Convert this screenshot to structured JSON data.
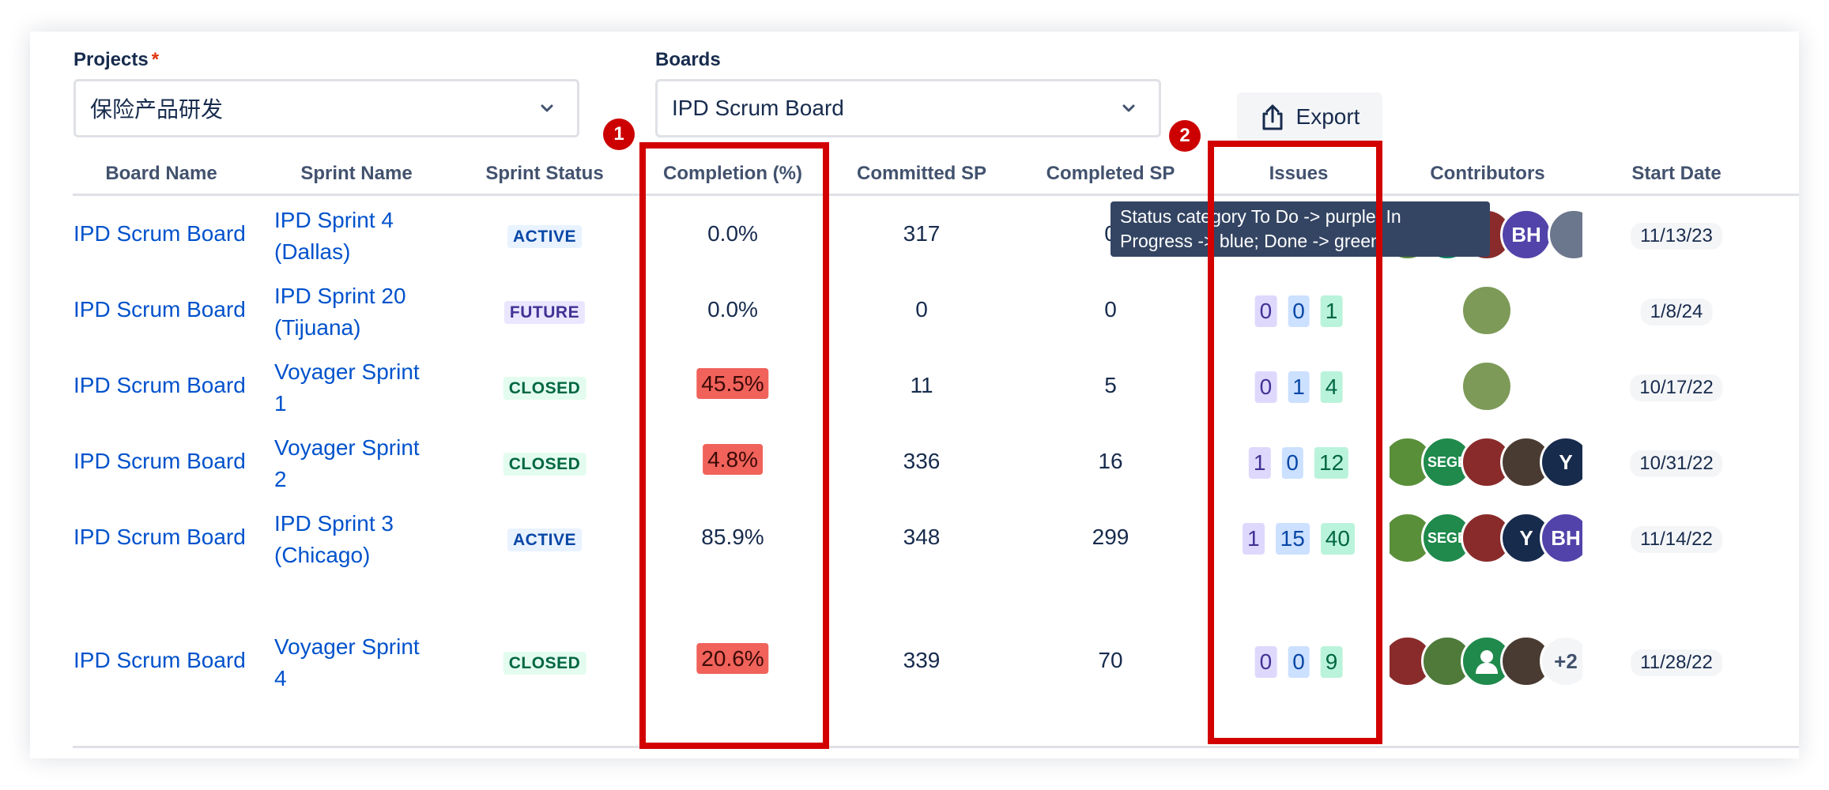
{
  "form": {
    "projects_label": "Projects",
    "required_mark": "*",
    "projects_value": "保险产品研发",
    "boards_label": "Boards",
    "boards_value": "IPD Scrum Board",
    "export_label": "Export"
  },
  "table": {
    "headers": [
      "Board Name",
      "Sprint Name",
      "Sprint Status",
      "Completion (%)",
      "Committed SP",
      "Completed SP",
      "Issues",
      "Contributors",
      "Start Date"
    ],
    "rows": [
      {
        "board": "IPD Scrum Board",
        "sprint_l1": "IPD Sprint 4",
        "sprint_l2": "(Dallas)",
        "status": "ACTIVE",
        "completion": "0.0%",
        "committed": "317",
        "completed": "0",
        "date": "11/13/23"
      },
      {
        "board": "IPD Scrum Board",
        "sprint_l1": "IPD Sprint 20",
        "sprint_l2": "(Tijuana)",
        "status": "FUTURE",
        "completion": "0.0%",
        "committed": "0",
        "completed": "0",
        "issues": {
          "todo": "0",
          "progress": "0",
          "done": "1"
        },
        "date": "1/8/24"
      },
      {
        "board": "IPD Scrum Board",
        "sprint_l1": "Voyager Sprint",
        "sprint_l2": "1",
        "status": "CLOSED",
        "completion": "45.5%",
        "committed": "11",
        "completed": "5",
        "issues": {
          "todo": "0",
          "progress": "1",
          "done": "4"
        },
        "date": "10/17/22"
      },
      {
        "board": "IPD Scrum Board",
        "sprint_l1": "Voyager Sprint",
        "sprint_l2": "2",
        "status": "CLOSED",
        "completion": "4.8%",
        "committed": "336",
        "completed": "16",
        "issues": {
          "todo": "1",
          "progress": "0",
          "done": "12"
        },
        "date": "10/31/22"
      },
      {
        "board": "IPD Scrum Board",
        "sprint_l1": "IPD Sprint 3",
        "sprint_l2": "(Chicago)",
        "status": "ACTIVE",
        "completion": "85.9%",
        "committed": "348",
        "completed": "299",
        "issues": {
          "todo": "1",
          "progress": "15",
          "done": "40"
        },
        "date": "11/14/22"
      },
      {
        "board": "IPD Scrum Board",
        "sprint_l1": "Voyager Sprint",
        "sprint_l2": "4",
        "status": "CLOSED",
        "completion": "20.6%",
        "committed": "339",
        "completed": "70",
        "issues": {
          "todo": "0",
          "progress": "0",
          "done": "9"
        },
        "date": "11/28/22"
      }
    ],
    "avatar_initials": {
      "bh": "BH",
      "sege": "SEGE",
      "y": "Y",
      "overflow": "+2"
    }
  },
  "tooltip": {
    "line1": "Status category To Do -> purple; In",
    "line2": "Progress -> blue; Done -> green"
  },
  "annotations": {
    "marker1": "1",
    "marker2": "2"
  },
  "colors": {
    "link": "#0052cc",
    "todo": "#dfd8fd",
    "progress": "#cce0ff",
    "done": "#baf3db",
    "low_completion": "#f0625a",
    "annotation_red": "#d30000"
  }
}
